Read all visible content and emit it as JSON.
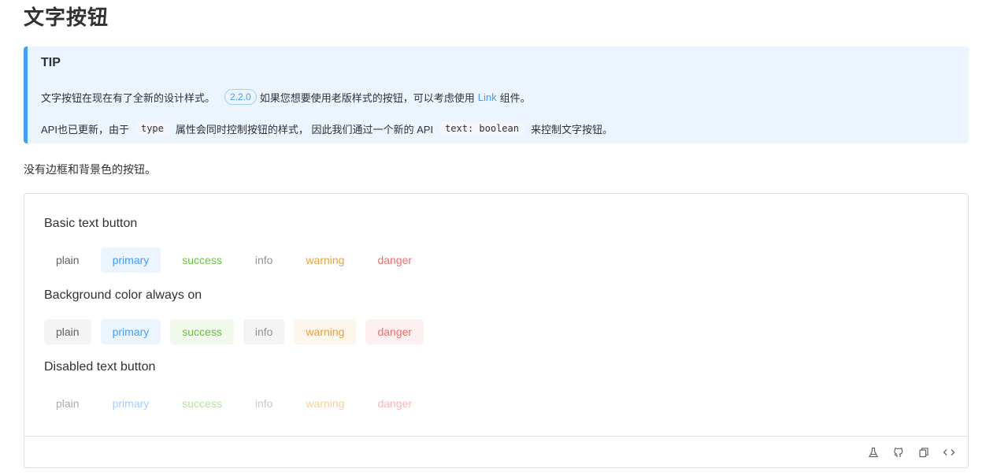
{
  "title": "文字按钮",
  "tip": {
    "title": "TIP",
    "line1_before": "文字按钮在现在有了全新的设计样式。",
    "version": "2.2.0",
    "line1_mid": "如果您想要使用老版样式的按钮，可以考虑使用",
    "link": "Link",
    "line1_after": "组件。",
    "line2_before": "API也已更新，由于",
    "code1": "type",
    "line2_mid": "属性会同时控制按钮的样式， 因此我们通过一个新的 API",
    "code2": "text: boolean",
    "line2_after": "来控制文字按钮。"
  },
  "description": "没有边框和背景色的按钮。",
  "groups": [
    {
      "label": "Basic text button",
      "buttons": [
        "plain",
        "primary",
        "success",
        "info",
        "warning",
        "danger"
      ]
    },
    {
      "label": "Background color always on",
      "buttons": [
        "plain",
        "primary",
        "success",
        "info",
        "warning",
        "danger"
      ]
    },
    {
      "label": "Disabled text button",
      "buttons": [
        "plain",
        "primary",
        "success",
        "info",
        "warning",
        "danger"
      ]
    }
  ],
  "footer_icons": [
    "playground-icon",
    "github-icon",
    "copy-icon",
    "code-icon"
  ],
  "colors": {
    "primary": "#409eff",
    "success": "#67c23a",
    "info": "#909399",
    "warning": "#e6a23c",
    "danger": "#f56c6c",
    "plain": "#606266"
  }
}
